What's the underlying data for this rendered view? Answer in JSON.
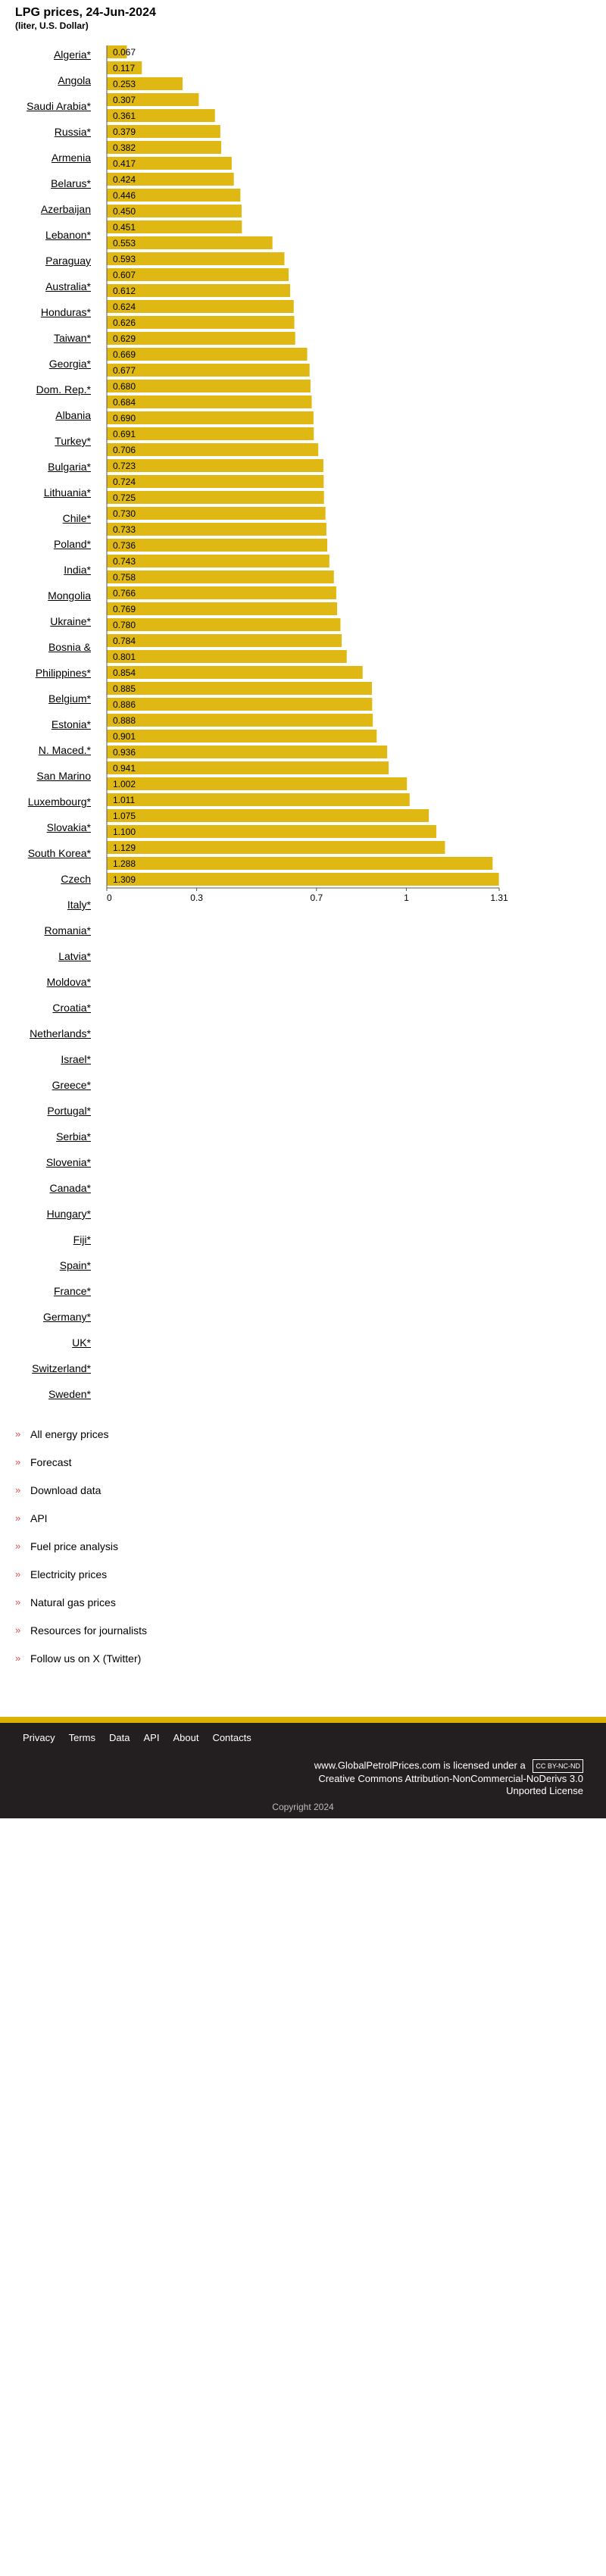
{
  "page": {
    "title": "LPG prices, 24-Jun-2024",
    "subtitle": "(liter, U.S. Dollar)"
  },
  "countries": [
    "Algeria*",
    "Angola",
    "Saudi Arabia*",
    "Russia*",
    "Armenia",
    "Belarus*",
    "Azerbaijan",
    "Lebanon*",
    "Paraguay",
    "Australia*",
    "Honduras*",
    "Taiwan*",
    "Georgia*",
    "Dom. Rep.*",
    "Albania",
    "Turkey*",
    "Bulgaria*",
    "Lithuania*",
    "Chile*",
    "Poland*",
    "India*",
    "Mongolia",
    "Ukraine*",
    "Bosnia &",
    "Philippines*",
    "Belgium*",
    "Estonia*",
    "N. Maced.*",
    "San Marino",
    "Luxembourg*",
    "Slovakia*",
    "South Korea*",
    "Czech",
    "Italy*",
    "Romania*",
    "Latvia*",
    "Moldova*",
    "Croatia*",
    "Netherlands*",
    "Israel*",
    "Greece*",
    "Portugal*",
    "Serbia*",
    "Slovenia*",
    "Canada*",
    "Hungary*",
    "Fiji*",
    "Spain*",
    "France*",
    "Germany*",
    "UK*",
    "Switzerland*",
    "Sweden*"
  ],
  "chart_data": {
    "type": "bar",
    "orientation": "horizontal",
    "bar_color": "#e0b814",
    "values": [
      0.067,
      0.117,
      0.253,
      0.307,
      0.361,
      0.379,
      0.382,
      0.417,
      0.424,
      0.446,
      0.45,
      0.451,
      0.553,
      0.593,
      0.607,
      0.612,
      0.624,
      0.626,
      0.629,
      0.669,
      0.677,
      0.68,
      0.684,
      0.69,
      0.691,
      0.706,
      0.723,
      0.724,
      0.725,
      0.73,
      0.733,
      0.736,
      0.743,
      0.758,
      0.766,
      0.769,
      0.78,
      0.784,
      0.801,
      0.854,
      0.885,
      0.886,
      0.888,
      0.901,
      0.936,
      0.941,
      1.002,
      1.011,
      1.075,
      1.1,
      1.129,
      1.288,
      1.309
    ],
    "value_labels": [
      "0.067",
      "0.117",
      "0.253",
      "0.307",
      "0.361",
      "0.379",
      "0.382",
      "0.417",
      "0.424",
      "0.446",
      "0.450",
      "0.451",
      "0.553",
      "0.593",
      "0.607",
      "0.612",
      "0.624",
      "0.626",
      "0.629",
      "0.669",
      "0.677",
      "0.680",
      "0.684",
      "0.690",
      "0.691",
      "0.706",
      "0.723",
      "0.724",
      "0.725",
      "0.730",
      "0.733",
      "0.736",
      "0.743",
      "0.758",
      "0.766",
      "0.769",
      "0.780",
      "0.784",
      "0.801",
      "0.854",
      "0.885",
      "0.886",
      "0.888",
      "0.901",
      "0.936",
      "0.941",
      "1.002",
      "1.011",
      "1.075",
      "1.100",
      "1.129",
      "1.288",
      "1.309"
    ],
    "xticks": [
      0,
      0.3,
      0.7,
      1,
      1.31
    ],
    "xtick_labels": [
      "0",
      "0.3",
      "0.7",
      "1",
      "1.31"
    ],
    "xlim": [
      0,
      1.31
    ],
    "grid": false
  },
  "menu": [
    "All energy prices",
    "Forecast",
    "Download data",
    "API",
    "Fuel price analysis",
    "Electricity prices",
    "Natural gas prices",
    "Resources for journalists",
    "Follow us on X (Twitter)"
  ],
  "footer": {
    "links": [
      "Privacy",
      "Terms",
      "Data",
      "API",
      "About",
      "Contacts"
    ],
    "license_line1": "www.GlobalPetrolPrices.com is licensed under a",
    "license_badge": "CC BY-NC-ND",
    "license_line2": "Creative Commons Attribution-NonCommercial-NoDerivs 3.0",
    "license_line3": "Unported License",
    "copyright": "Copyright 2024"
  }
}
